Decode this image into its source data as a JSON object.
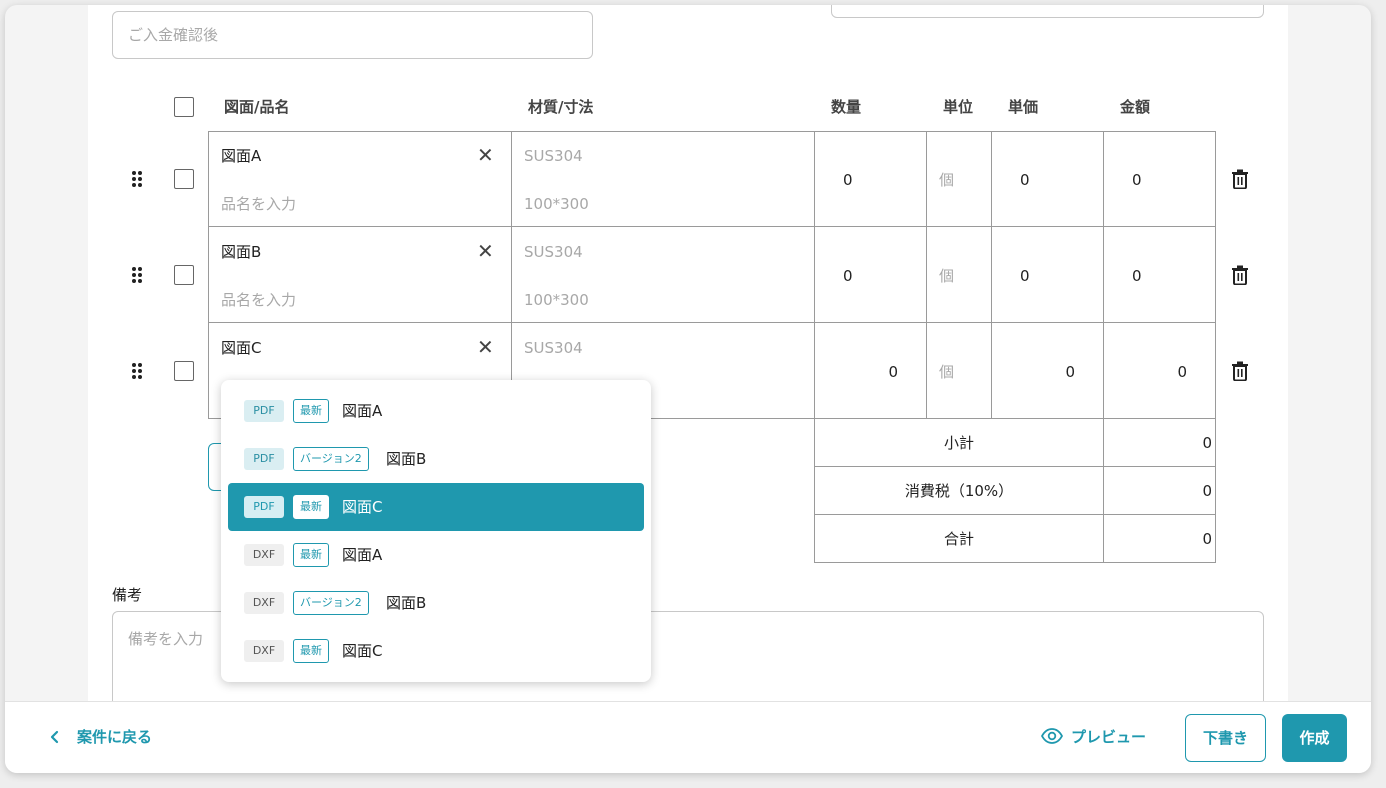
{
  "payment_field": {
    "placeholder": "ご入金確認後"
  },
  "table": {
    "headers": {
      "drawing": "図面/品名",
      "material": "材質/寸法",
      "qty": "数量",
      "unit": "単位",
      "unit_price": "単価",
      "amount": "金額"
    },
    "rows": [
      {
        "drawing": "図面A",
        "name_placeholder": "品名を入力",
        "material_placeholder": "SUS304",
        "size_placeholder": "100*300",
        "qty": "0",
        "unit_placeholder": "個",
        "unit_price": "0",
        "amount": "0"
      },
      {
        "drawing": "図面B",
        "name_placeholder": "品名を入力",
        "material_placeholder": "SUS304",
        "size_placeholder": "100*300",
        "qty": "0",
        "unit_placeholder": "個",
        "unit_price": "0",
        "amount": "0"
      },
      {
        "drawing": "図面C",
        "material_placeholder": "SUS304",
        "qty": "0",
        "unit_placeholder": "個",
        "unit_price": "0",
        "amount": "0"
      }
    ],
    "totals": [
      {
        "label": "小計",
        "value": "0"
      },
      {
        "label": "消費税（10%）",
        "value": "0"
      },
      {
        "label": "合計",
        "value": "0"
      }
    ]
  },
  "dropdown": {
    "options": [
      {
        "type": "PDF",
        "version": "最新",
        "name": "図面A",
        "selected": false
      },
      {
        "type": "PDF",
        "version": "バージョン2",
        "name": "図面B",
        "selected": false
      },
      {
        "type": "PDF",
        "version": "最新",
        "name": "図面C",
        "selected": true
      },
      {
        "type": "DXF",
        "version": "最新",
        "name": "図面A",
        "selected": false
      },
      {
        "type": "DXF",
        "version": "バージョン2",
        "name": "図面B",
        "selected": false
      },
      {
        "type": "DXF",
        "version": "最新",
        "name": "図面C",
        "selected": false
      }
    ]
  },
  "notes": {
    "label": "備考",
    "placeholder": "備考を入力"
  },
  "footer": {
    "back_label": "案件に戻る",
    "preview_label": "プレビュー",
    "draft_label": "下書き",
    "create_label": "作成"
  },
  "colors": {
    "accent": "#1f98ae",
    "border": "#9a9a9a",
    "placeholder": "#a8a8a8"
  }
}
